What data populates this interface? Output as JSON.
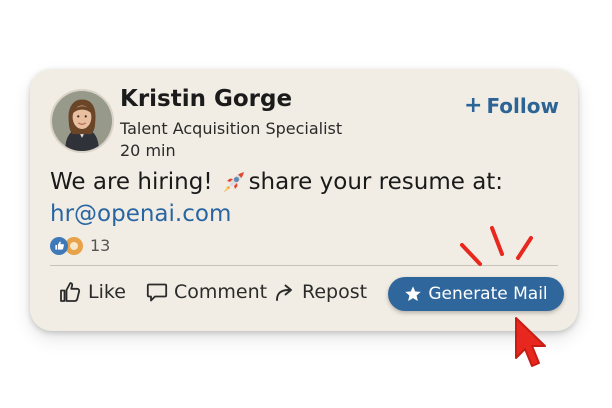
{
  "post": {
    "author_name": "Kristin Gorge",
    "author_title": "Talent Acquisition Specialist",
    "time_ago": "20 min",
    "follow_label": "Follow",
    "text_before_emoji": "We are hiring!",
    "text_after_emoji": "share your resume at:",
    "email": "hr@openai.com",
    "reaction_count": "13"
  },
  "actions": {
    "like_label": "Like",
    "comment_label": "Comment",
    "repost_label": "Repost",
    "generate_mail_label": "Generate Mail"
  },
  "icons": {
    "follow": "plus-icon",
    "emoji": "rocket-icon",
    "reaction_like": "thumbs-up-icon",
    "reaction_other": "celebrate-icon",
    "like": "thumbs-up-icon",
    "comment": "comment-icon",
    "repost": "repost-icon",
    "generate_mail": "star-icon",
    "pointer": "cursor-icon"
  },
  "colors": {
    "card_background": "#f2ede4",
    "accent_blue": "#2f679d",
    "link_blue": "#2866a3",
    "highlight_red": "#e8281e"
  }
}
